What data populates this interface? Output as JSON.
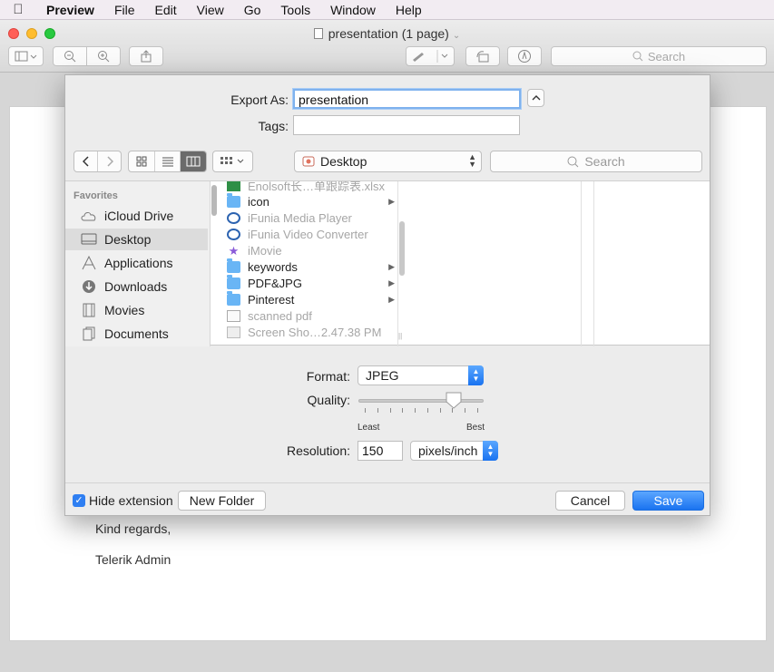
{
  "menubar": {
    "apple_icon": "apple-logo-icon",
    "items": [
      "Preview",
      "File",
      "Edit",
      "View",
      "Go",
      "Tools",
      "Window",
      "Help"
    ]
  },
  "window": {
    "title": "presentation (1 page)",
    "toolbar_search_placeholder": "Search"
  },
  "document": {
    "lines": [
      "Kind regards,",
      "Telerik Admin"
    ]
  },
  "dialog": {
    "export_as_label": "Export As:",
    "export_as_value": "presentation",
    "tags_label": "Tags:",
    "tags_value": "",
    "location": "Desktop",
    "search_placeholder": "Search",
    "sidebar": {
      "header": "Favorites",
      "items": [
        {
          "label": "iCloud Drive",
          "icon": "cloud-icon"
        },
        {
          "label": "Desktop",
          "icon": "desktop-icon"
        },
        {
          "label": "Applications",
          "icon": "applications-icon"
        },
        {
          "label": "Downloads",
          "icon": "downloads-icon"
        },
        {
          "label": "Movies",
          "icon": "movies-icon"
        },
        {
          "label": "Documents",
          "icon": "documents-icon"
        }
      ]
    },
    "files": [
      {
        "name": "Enolsoft长…单跟踪表.xlsx",
        "type": "xls",
        "dim": true
      },
      {
        "name": "icon",
        "type": "folder",
        "dim": false
      },
      {
        "name": "iFunia Media Player",
        "type": "media",
        "dim": true
      },
      {
        "name": "iFunia Video Converter",
        "type": "media",
        "dim": true
      },
      {
        "name": "iMovie",
        "type": "imovie",
        "dim": true
      },
      {
        "name": "keywords",
        "type": "folder",
        "dim": false
      },
      {
        "name": "PDF&JPG",
        "type": "folder",
        "dim": false
      },
      {
        "name": "Pinterest",
        "type": "folder",
        "dim": false
      },
      {
        "name": "scanned pdf",
        "type": "doc",
        "dim": true
      },
      {
        "name": "Screen Sho…2.47.38 PM",
        "type": "screen",
        "dim": true
      }
    ],
    "format_label": "Format:",
    "format_value": "JPEG",
    "quality_label": "Quality:",
    "quality_level": 0.8,
    "quality_min_label": "Least",
    "quality_max_label": "Best",
    "resolution_label": "Resolution:",
    "resolution_value": "150",
    "resolution_unit": "pixels/inch",
    "hide_extension_label": "Hide extension",
    "hide_extension_checked": true,
    "new_folder_label": "New Folder",
    "cancel_label": "Cancel",
    "save_label": "Save"
  }
}
